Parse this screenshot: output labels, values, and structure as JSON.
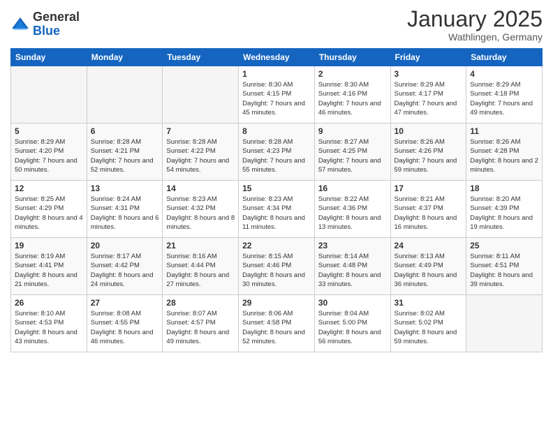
{
  "logo": {
    "general": "General",
    "blue": "Blue"
  },
  "header": {
    "month": "January 2025",
    "location": "Wathlingen, Germany"
  },
  "days_of_week": [
    "Sunday",
    "Monday",
    "Tuesday",
    "Wednesday",
    "Thursday",
    "Friday",
    "Saturday"
  ],
  "weeks": [
    [
      {
        "day": "",
        "detail": ""
      },
      {
        "day": "",
        "detail": ""
      },
      {
        "day": "",
        "detail": ""
      },
      {
        "day": "1",
        "detail": "Sunrise: 8:30 AM\nSunset: 4:15 PM\nDaylight: 7 hours\nand 45 minutes."
      },
      {
        "day": "2",
        "detail": "Sunrise: 8:30 AM\nSunset: 4:16 PM\nDaylight: 7 hours\nand 46 minutes."
      },
      {
        "day": "3",
        "detail": "Sunrise: 8:29 AM\nSunset: 4:17 PM\nDaylight: 7 hours\nand 47 minutes."
      },
      {
        "day": "4",
        "detail": "Sunrise: 8:29 AM\nSunset: 4:18 PM\nDaylight: 7 hours\nand 49 minutes."
      }
    ],
    [
      {
        "day": "5",
        "detail": "Sunrise: 8:29 AM\nSunset: 4:20 PM\nDaylight: 7 hours\nand 50 minutes."
      },
      {
        "day": "6",
        "detail": "Sunrise: 8:28 AM\nSunset: 4:21 PM\nDaylight: 7 hours\nand 52 minutes."
      },
      {
        "day": "7",
        "detail": "Sunrise: 8:28 AM\nSunset: 4:22 PM\nDaylight: 7 hours\nand 54 minutes."
      },
      {
        "day": "8",
        "detail": "Sunrise: 8:28 AM\nSunset: 4:23 PM\nDaylight: 7 hours\nand 55 minutes."
      },
      {
        "day": "9",
        "detail": "Sunrise: 8:27 AM\nSunset: 4:25 PM\nDaylight: 7 hours\nand 57 minutes."
      },
      {
        "day": "10",
        "detail": "Sunrise: 8:26 AM\nSunset: 4:26 PM\nDaylight: 7 hours\nand 59 minutes."
      },
      {
        "day": "11",
        "detail": "Sunrise: 8:26 AM\nSunset: 4:28 PM\nDaylight: 8 hours\nand 2 minutes."
      }
    ],
    [
      {
        "day": "12",
        "detail": "Sunrise: 8:25 AM\nSunset: 4:29 PM\nDaylight: 8 hours\nand 4 minutes."
      },
      {
        "day": "13",
        "detail": "Sunrise: 8:24 AM\nSunset: 4:31 PM\nDaylight: 8 hours\nand 6 minutes."
      },
      {
        "day": "14",
        "detail": "Sunrise: 8:23 AM\nSunset: 4:32 PM\nDaylight: 8 hours\nand 8 minutes."
      },
      {
        "day": "15",
        "detail": "Sunrise: 8:23 AM\nSunset: 4:34 PM\nDaylight: 8 hours\nand 11 minutes."
      },
      {
        "day": "16",
        "detail": "Sunrise: 8:22 AM\nSunset: 4:36 PM\nDaylight: 8 hours\nand 13 minutes."
      },
      {
        "day": "17",
        "detail": "Sunrise: 8:21 AM\nSunset: 4:37 PM\nDaylight: 8 hours\nand 16 minutes."
      },
      {
        "day": "18",
        "detail": "Sunrise: 8:20 AM\nSunset: 4:39 PM\nDaylight: 8 hours\nand 19 minutes."
      }
    ],
    [
      {
        "day": "19",
        "detail": "Sunrise: 8:19 AM\nSunset: 4:41 PM\nDaylight: 8 hours\nand 21 minutes."
      },
      {
        "day": "20",
        "detail": "Sunrise: 8:17 AM\nSunset: 4:42 PM\nDaylight: 8 hours\nand 24 minutes."
      },
      {
        "day": "21",
        "detail": "Sunrise: 8:16 AM\nSunset: 4:44 PM\nDaylight: 8 hours\nand 27 minutes."
      },
      {
        "day": "22",
        "detail": "Sunrise: 8:15 AM\nSunset: 4:46 PM\nDaylight: 8 hours\nand 30 minutes."
      },
      {
        "day": "23",
        "detail": "Sunrise: 8:14 AM\nSunset: 4:48 PM\nDaylight: 8 hours\nand 33 minutes."
      },
      {
        "day": "24",
        "detail": "Sunrise: 8:13 AM\nSunset: 4:49 PM\nDaylight: 8 hours\nand 36 minutes."
      },
      {
        "day": "25",
        "detail": "Sunrise: 8:11 AM\nSunset: 4:51 PM\nDaylight: 8 hours\nand 39 minutes."
      }
    ],
    [
      {
        "day": "26",
        "detail": "Sunrise: 8:10 AM\nSunset: 4:53 PM\nDaylight: 8 hours\nand 43 minutes."
      },
      {
        "day": "27",
        "detail": "Sunrise: 8:08 AM\nSunset: 4:55 PM\nDaylight: 8 hours\nand 46 minutes."
      },
      {
        "day": "28",
        "detail": "Sunrise: 8:07 AM\nSunset: 4:57 PM\nDaylight: 8 hours\nand 49 minutes."
      },
      {
        "day": "29",
        "detail": "Sunrise: 8:06 AM\nSunset: 4:58 PM\nDaylight: 8 hours\nand 52 minutes."
      },
      {
        "day": "30",
        "detail": "Sunrise: 8:04 AM\nSunset: 5:00 PM\nDaylight: 8 hours\nand 56 minutes."
      },
      {
        "day": "31",
        "detail": "Sunrise: 8:02 AM\nSunset: 5:02 PM\nDaylight: 8 hours\nand 59 minutes."
      },
      {
        "day": "",
        "detail": ""
      }
    ]
  ]
}
